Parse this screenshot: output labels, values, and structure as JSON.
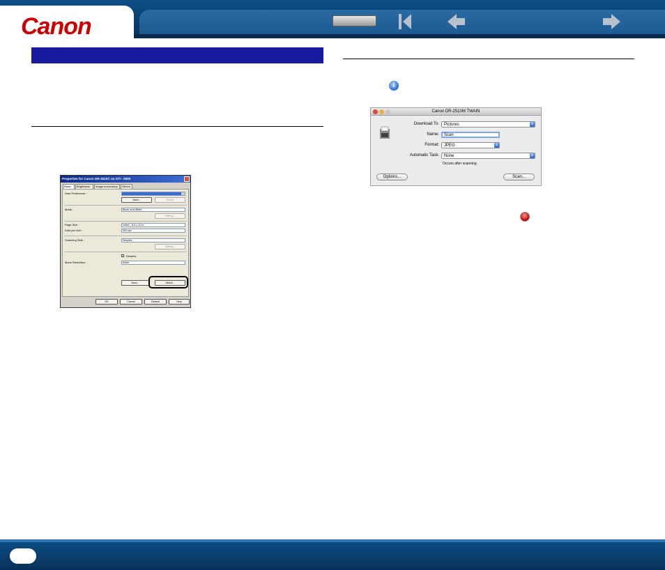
{
  "header": {
    "brand": "Canon",
    "nav": {
      "toc_button": "",
      "first_page": "first-page-icon",
      "previous_page": "arrow-left-icon",
      "next_page": "arrow-right-icon"
    }
  },
  "footer": {
    "page_number": ""
  },
  "win_dialog": {
    "title": "Properties for Canon DR-2510C on STI - 0000",
    "tabs": [
      "Basic",
      "Brightness",
      "Image processing",
      "Others"
    ],
    "user_preference_label": "User Preference :",
    "save_label": "Save...",
    "delete_label": "Delete",
    "mode_label": "Mode :",
    "mode_value": "Black and White",
    "setting_label": "Setting...",
    "page_size_label": "Page Size :",
    "page_size_value": "Letter - 8.5 x 11 in",
    "dpi_label": "Dots per inch :",
    "dpi_value": "300 dpi",
    "scanning_side_label": "Scanning Side :",
    "scanning_side_value": "Simplex",
    "setting_label_2": "Setting...",
    "deskew_label": "Deskew",
    "moire_label": "Moire Reduction :",
    "moire_value": "None",
    "area_label": "Area...",
    "about_label": "About...",
    "ok_label": "OK",
    "cancel_label": "Cancel",
    "default_label": "Default",
    "help_label": "Help"
  },
  "mac_dialog": {
    "title": "Canon DR-2510M TWAIN",
    "download_to_label": "Download To:",
    "download_to_value": "Pictures",
    "name_label": "Name:",
    "name_value": "Scan",
    "format_label": "Format:",
    "format_value": "JPEG",
    "auto_task_label": "Automatic Task:",
    "auto_task_value": "None",
    "auto_task_hint": "Occurs after scanning",
    "options_label": "Options...",
    "scan_label": "Scan..."
  },
  "colors": {
    "header_blue": "#0b3f70",
    "section_bar": "#1a1a9e",
    "canon_red": "#cc0000"
  }
}
